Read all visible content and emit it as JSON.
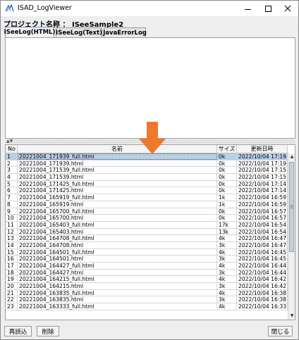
{
  "window": {
    "title": "ISAD_LogViewer"
  },
  "project": {
    "label": "プロジェクト名称 ：",
    "name": "ISeeSample2"
  },
  "tabs": [
    {
      "label": "ISeeLog(HTML)",
      "active": true
    },
    {
      "label": "ISeeLog(Text)",
      "active": false
    },
    {
      "label": "JavaErrorLog",
      "active": false
    }
  ],
  "table": {
    "headers": {
      "no": "No",
      "name": "名前",
      "size": "サイズ",
      "date": "更新日時"
    },
    "selected_index": 0,
    "rows": [
      {
        "no": "1",
        "name": "20221004_171939_full.html",
        "size": "0k",
        "date": "2022/10/04 17:19:39"
      },
      {
        "no": "2",
        "name": "20221004_171939.html",
        "size": "0k",
        "date": "2022/10/04 17:19:39"
      },
      {
        "no": "3",
        "name": "20221004_171539_full.html",
        "size": "0k",
        "date": "2022/10/04 17:15:39"
      },
      {
        "no": "4",
        "name": "20221004_171539.html",
        "size": "0k",
        "date": "2022/10/04 17:15:39"
      },
      {
        "no": "5",
        "name": "20221004_171425_full.html",
        "size": "0k",
        "date": "2022/10/04 17:14:25"
      },
      {
        "no": "6",
        "name": "20221004_171425.html",
        "size": "0k",
        "date": "2022/10/04 17:14:25"
      },
      {
        "no": "7",
        "name": "20221004_165919_full.html",
        "size": "1k",
        "date": "2022/10/04 16:59:23"
      },
      {
        "no": "8",
        "name": "20221004_165919.html",
        "size": "1k",
        "date": "2022/10/04 16:59:23"
      },
      {
        "no": "9",
        "name": "20221004_165700_full.html",
        "size": "0k",
        "date": "2022/10/04 16:57:08"
      },
      {
        "no": "10",
        "name": "20221004_165700.html",
        "size": "0k",
        "date": "2022/10/04 16:57:08"
      },
      {
        "no": "11",
        "name": "20221004_165403_full.html",
        "size": "17k",
        "date": "2022/10/04 16:54:40"
      },
      {
        "no": "12",
        "name": "20221004_165403.html",
        "size": "13k",
        "date": "2022/10/04 16:54:40"
      },
      {
        "no": "13",
        "name": "20221004_164708_full.html",
        "size": "4k",
        "date": "2022/10/04 16:47:15"
      },
      {
        "no": "14",
        "name": "20221004_164708.html",
        "size": "3k",
        "date": "2022/10/04 16:47:15"
      },
      {
        "no": "15",
        "name": "20221004_164501_full.html",
        "size": "4k",
        "date": "2022/10/04 16:45:08"
      },
      {
        "no": "16",
        "name": "20221004_164501.html",
        "size": "3k",
        "date": "2022/10/04 16:45:08"
      },
      {
        "no": "17",
        "name": "20221004_164427_full.html",
        "size": "4k",
        "date": "2022/10/04 16:44:34"
      },
      {
        "no": "18",
        "name": "20221004_164427.html",
        "size": "3k",
        "date": "2022/10/04 16:44:34"
      },
      {
        "no": "19",
        "name": "20221004_164215_full.html",
        "size": "4k",
        "date": "2022/10/04 16:42:23"
      },
      {
        "no": "20",
        "name": "20221004_164215.html",
        "size": "3k",
        "date": "2022/10/04 16:42:23"
      },
      {
        "no": "21",
        "name": "20221004_163835_full.html",
        "size": "4k",
        "date": "2022/10/04 16:38:42"
      },
      {
        "no": "22",
        "name": "20221004_163835.html",
        "size": "3k",
        "date": "2022/10/04 16:38:42"
      },
      {
        "no": "23",
        "name": "20221004_163333_full.html",
        "size": "4k",
        "date": "2022/10/04 16:33:40"
      }
    ]
  },
  "buttons": {
    "reload": "再読込",
    "delete": "削除",
    "close": "閉じる"
  },
  "icons": {
    "app": "app-logo-icon",
    "minimize": "minimize-icon",
    "maximize": "maximize-icon",
    "close": "close-icon",
    "scroll_up": "scroll-up-icon",
    "scroll_down": "scroll-down-icon",
    "annotation": "down-arrow-icon"
  },
  "colors": {
    "selected_row": "#b8cfe8",
    "annotation_arrow": "#f0782a",
    "active_tab_border": "#7a9cc6"
  }
}
